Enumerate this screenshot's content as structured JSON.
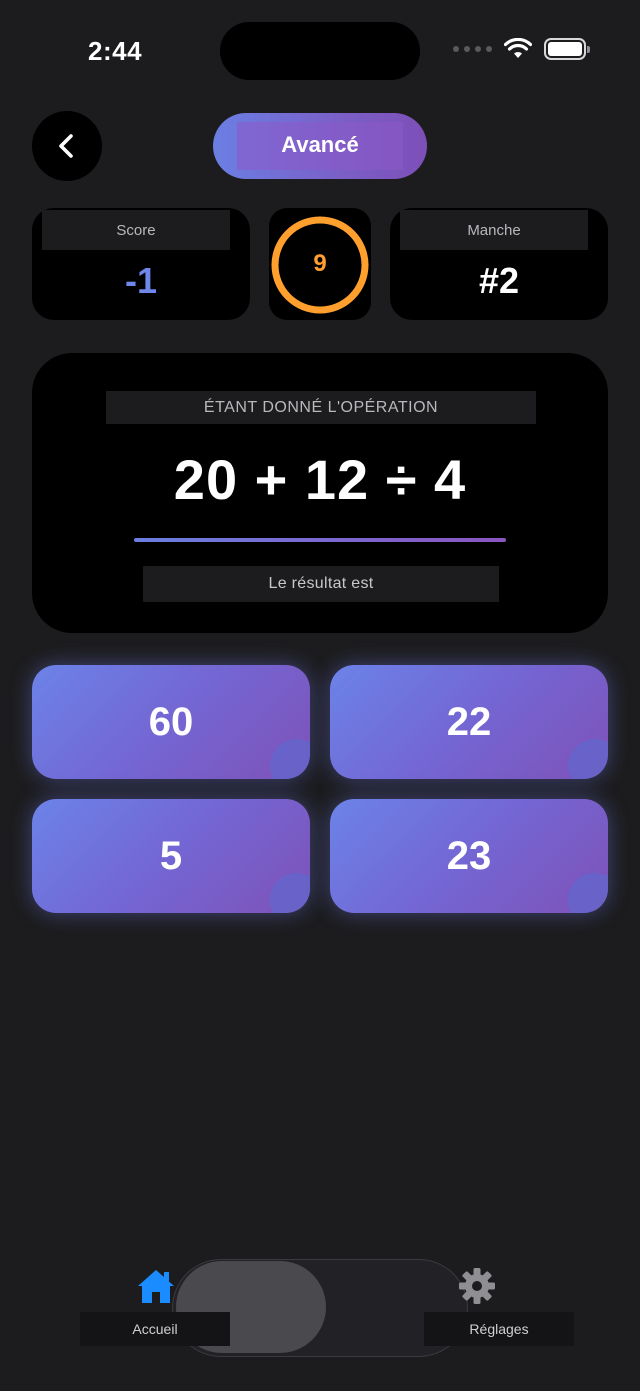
{
  "status_bar": {
    "time": "2:44"
  },
  "header": {
    "level_label": "Avancé"
  },
  "stats": {
    "score_label": "Score",
    "score_value": "-1",
    "timer_value": "9",
    "round_label": "Manche",
    "round_value": "#2"
  },
  "question": {
    "label": "ÉTANT DONNÉ L'OPÉRATION",
    "expression": "20 + 12 ÷ 4",
    "prompt": "Le résultat est"
  },
  "answers": [
    "60",
    "22",
    "5",
    "23"
  ],
  "tab_bar": {
    "home_label": "Accueil",
    "settings_label": "Réglages"
  },
  "colors": {
    "accent": "#6f86ea",
    "timer": "#ff9f2e",
    "tab_active": "#1a8cff"
  }
}
